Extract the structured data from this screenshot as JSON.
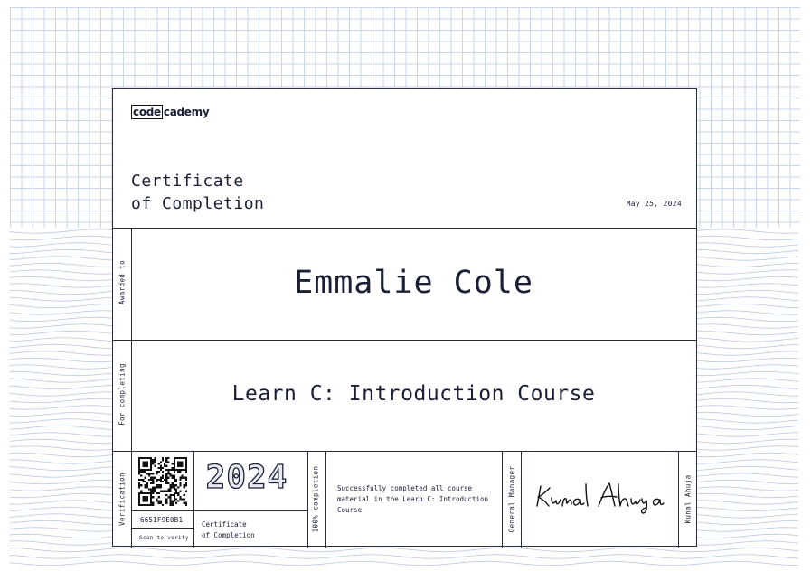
{
  "brand": {
    "logo_box": "code",
    "logo_rest": "cademy"
  },
  "certificate": {
    "title": "Certificate\nof Completion",
    "date": "May 25, 2024",
    "awarded_to_label": "Awarded to",
    "recipient_name": "Emmalie Cole",
    "for_completing_label": "For completing",
    "course_name": "Learn C: Introduction Course"
  },
  "footer": {
    "verification_label": "Verification",
    "certificate_id": "6651F9E0B1",
    "scan_label": "Scan to verify",
    "year": "2024",
    "certificate_label": "Certificate\nof Completion",
    "completion_label": "100% completion",
    "description": "Successfully completed all course material in the Learn C: Introduction Course",
    "signer_title": "General Manager",
    "signature_text": "Kunal Ahuja",
    "signer_name": "Kunal Ahuja"
  },
  "colors": {
    "ink": "#1a1f36",
    "grid": "#c9d6e8",
    "border": "#2a2e3a"
  }
}
